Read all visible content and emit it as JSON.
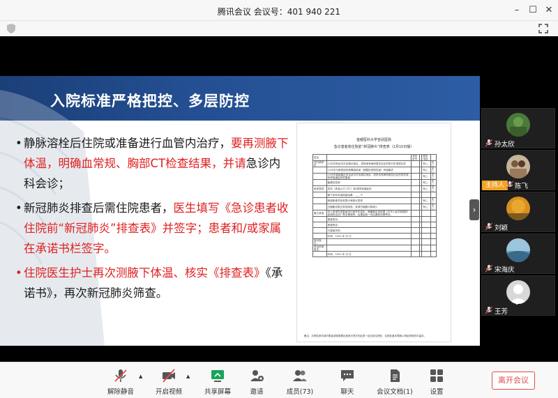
{
  "window": {
    "title": "腾讯会议 会议号：401 940 221"
  },
  "slide": {
    "title": "入院标准严格把控、多层防控",
    "bullets": [
      {
        "dot": "•",
        "normal1": "静脉溶栓后住院或准备进行血管内治疗，",
        "red1": "要再测腋下体温，明确血常规、胸部CT检查结果，并请",
        "normal2": "急诊内科会诊；"
      },
      {
        "dot": "•",
        "normal1": "新冠肺炎排查后需住院患者，",
        "red1": "医生填写《急诊患者收住院前“新冠肺炎”排查表》并签字；患者和/或家属在承诺书栏签字。",
        "normal2": ""
      },
      {
        "dot": "•",
        "red1": "住院医生护士再次测腋下体温、核实《排查表》",
        "normal1": "《承诺书》，再次新冠肺炎筛查。"
      }
    ],
    "document": {
      "hospital": "首都医科大学宣武医院",
      "form_title": "急诊患者收住院前“新冠肺炎”排查表（2月10日版）",
      "rows": [
        [
          "姓名",
          "",
          "身份证号",
          "",
          "联系电话",
          ""
        ],
        [
          "流行病学史",
          "14天内有武汉市及周边地区，或其他有病例报告社区的旅行史或居住史",
          "",
          "",
          "有□",
          "无□"
        ],
        [
          "",
          "14天内与新型冠状病毒感染者（核酸检测阳性者）有接触史",
          "",
          "",
          "有□",
          "无□"
        ],
        [
          "",
          "14天内曾接触过来自武汉市及周边地区，或来自有病例报告社区的发热或有呼吸道症状的患者",
          "",
          "",
          "有□",
          "无□"
        ],
        [
          "",
          "聚集性发病",
          "",
          "",
          "有□",
          "无□"
        ],
        [
          "临床表现",
          "发热（体温≥37.3℃）和/或呼吸道症状",
          "",
          "",
          "有□",
          "无□"
        ],
        [
          "",
          "腋下实际体温测量结果：____℃",
          "",
          "",
          "",
          ""
        ],
        [
          "",
          "肺部影像学检查提示有肺炎表现",
          "",
          "",
          "有□",
          "无□"
        ],
        [
          "",
          "白细胞总数正常或减低，或淋巴细胞计数减少",
          "",
          "",
          "有□",
          "无□"
        ],
        [
          "患方承诺",
          "本人承诺所述患者流行病学史真实，隐瞒事实将依据《中华人民共和国传染病防治法》等法律追责，后果由我一切后果和法律责任。",
          "",
          "",
          "",
          ""
        ],
        [
          "",
          "患者签名：",
          "",
          "",
          "",
          ""
        ],
        [
          "",
          "家属签名：",
          "",
          "",
          "",
          ""
        ],
        [
          "",
          "与患者关系：",
          "",
          "",
          "",
          ""
        ],
        [
          "",
          "时间：2020 年  月  日",
          "",
          "",
          "",
          ""
        ],
        [
          "接诊医生：",
          "",
          "",
          "",
          "",
          ""
        ],
        [
          "收治科室医生：",
          "",
          "",
          "",
          "",
          ""
        ],
        [
          "",
          "时间：2020 年  月  日",
          "",
          "",
          "",
          ""
        ]
      ],
      "footer": "备注：办理住院手续时患者或家属需出具我已签字的此表一起交给住院处，住院处盖本表随入院纸质病历中留存。"
    }
  },
  "participants": [
    {
      "name": "孙太欣",
      "avatar_color": "#4a7a3a"
    },
    {
      "name": "陈飞",
      "avatar_color": "#c4b49a",
      "badge": "主持人"
    },
    {
      "name": "刘颖",
      "avatar_color": "#d89020"
    },
    {
      "name": "宋海庆",
      "avatar_color": "#6aa0c0"
    },
    {
      "name": "王芳",
      "avatar_color": "#d8d8d8"
    }
  ],
  "toolbar": {
    "unmute": "解除静音",
    "video": "开启视频",
    "share": "共享屏幕",
    "invite": "邀请",
    "members": "成员(73)",
    "chat": "聊天",
    "docs": "会议文档(1)",
    "settings": "设置",
    "leave": "离开会议"
  },
  "colors": {
    "accent_green": "#1aa35a",
    "leave_red": "#e14b4b",
    "host_badge": "#f2a427",
    "slide_header": "#244f92"
  }
}
